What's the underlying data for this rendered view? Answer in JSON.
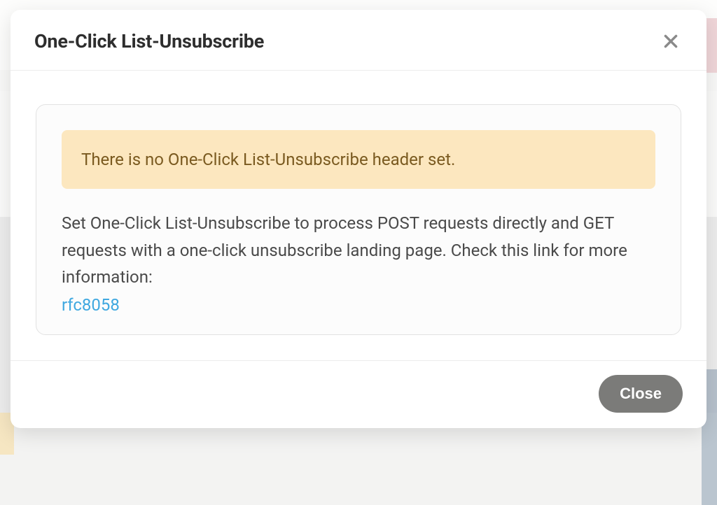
{
  "modal": {
    "title": "One-Click List-Unsubscribe",
    "alert_text": "There is no One-Click List-Unsubscribe header set.",
    "info_text": "Set One-Click List-Unsubscribe to process POST requests directly and GET requests with a one-click unsubscribe landing page. Check this link for more information:",
    "link_text": "rfc8058",
    "close_button_label": "Close"
  }
}
